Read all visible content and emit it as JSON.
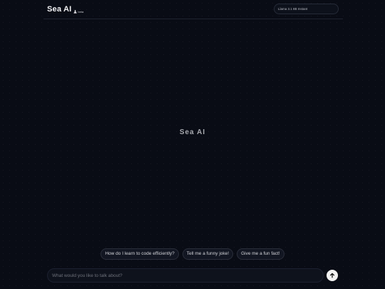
{
  "header": {
    "brand_name": "Sea AI",
    "beta_label": "beta",
    "model_selected": "Llama 3.1 8B Instant"
  },
  "main": {
    "center_title": "Sea AI"
  },
  "suggestions": [
    {
      "label": "How do I learn to code efficiently?"
    },
    {
      "label": "Tell me a funny joke!"
    },
    {
      "label": "Give me a fun fact!"
    }
  ],
  "composer": {
    "placeholder": "What would you like to talk about?",
    "value": "",
    "send_icon": "arrow-up-icon"
  },
  "colors": {
    "background": "#090c15",
    "accent": "#f2f2f2"
  }
}
